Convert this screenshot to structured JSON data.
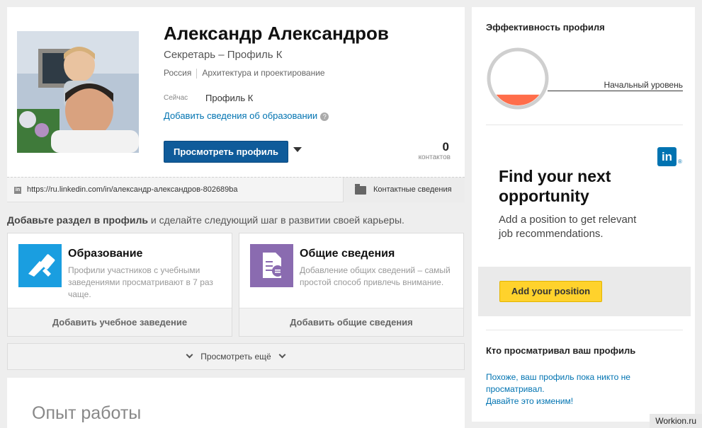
{
  "profile": {
    "name": "Александр Александров",
    "headline": "Секретарь – Профиль К",
    "location": "Россия",
    "industry": "Архитектура и проектирование",
    "current_label": "Сейчас",
    "current_value": "Профиль К",
    "add_education_link": "Добавить сведения об образовании",
    "help_glyph": "?",
    "view_profile_button": "Просмотреть профиль",
    "connections_count": "0",
    "connections_label": "контактов",
    "linkedin_glyph": "in",
    "public_url": "https://ru.linkedin.com/in/александр-александров-802689ba",
    "contact_info_button": "Контактные сведения"
  },
  "add_section": {
    "prompt_bold": "Добавьте раздел в профиль",
    "prompt_rest": " и сделайте следующий шаг в развитии своей карьеры.",
    "cards": [
      {
        "title": "Образование",
        "description": "Профили участников с учебными заведениями просматривают в 7 раз чаще.",
        "action": "Добавить учебное заведение",
        "icon": "graduation-icon",
        "color": "#1a9ee0"
      },
      {
        "title": "Общие сведения",
        "description": "Добавление общих сведений – самый простой способ привлечь внимание.",
        "action": "Добавить общие сведения",
        "icon": "document-icon",
        "color": "#8a6bb0"
      }
    ],
    "view_more": "Просмотреть ещё"
  },
  "experience": {
    "title": "Опыт работы"
  },
  "sidebar": {
    "strength_title": "Эффективность профиля",
    "strength_level": "Начальный уровень",
    "strength_fill_fraction": 0.2,
    "ad": {
      "logo_text": "in",
      "registered_mark": "®",
      "headline": "Find your next opportunity",
      "subtext": "Add a position to get relevant job recommendations.",
      "button": "Add your position"
    },
    "viewers_title": "Кто просматривал ваш профиль",
    "viewers_line1": "Похоже, ваш профиль пока никто не просматривал.",
    "viewers_line2": "Давайте это изменим!"
  },
  "watermark": "Workion.ru",
  "colors": {
    "primary_button": "#0f5b9a",
    "link": "#0073b1",
    "ad_button": "#ffd22c",
    "gauge_fill": "#ff6d4a"
  }
}
